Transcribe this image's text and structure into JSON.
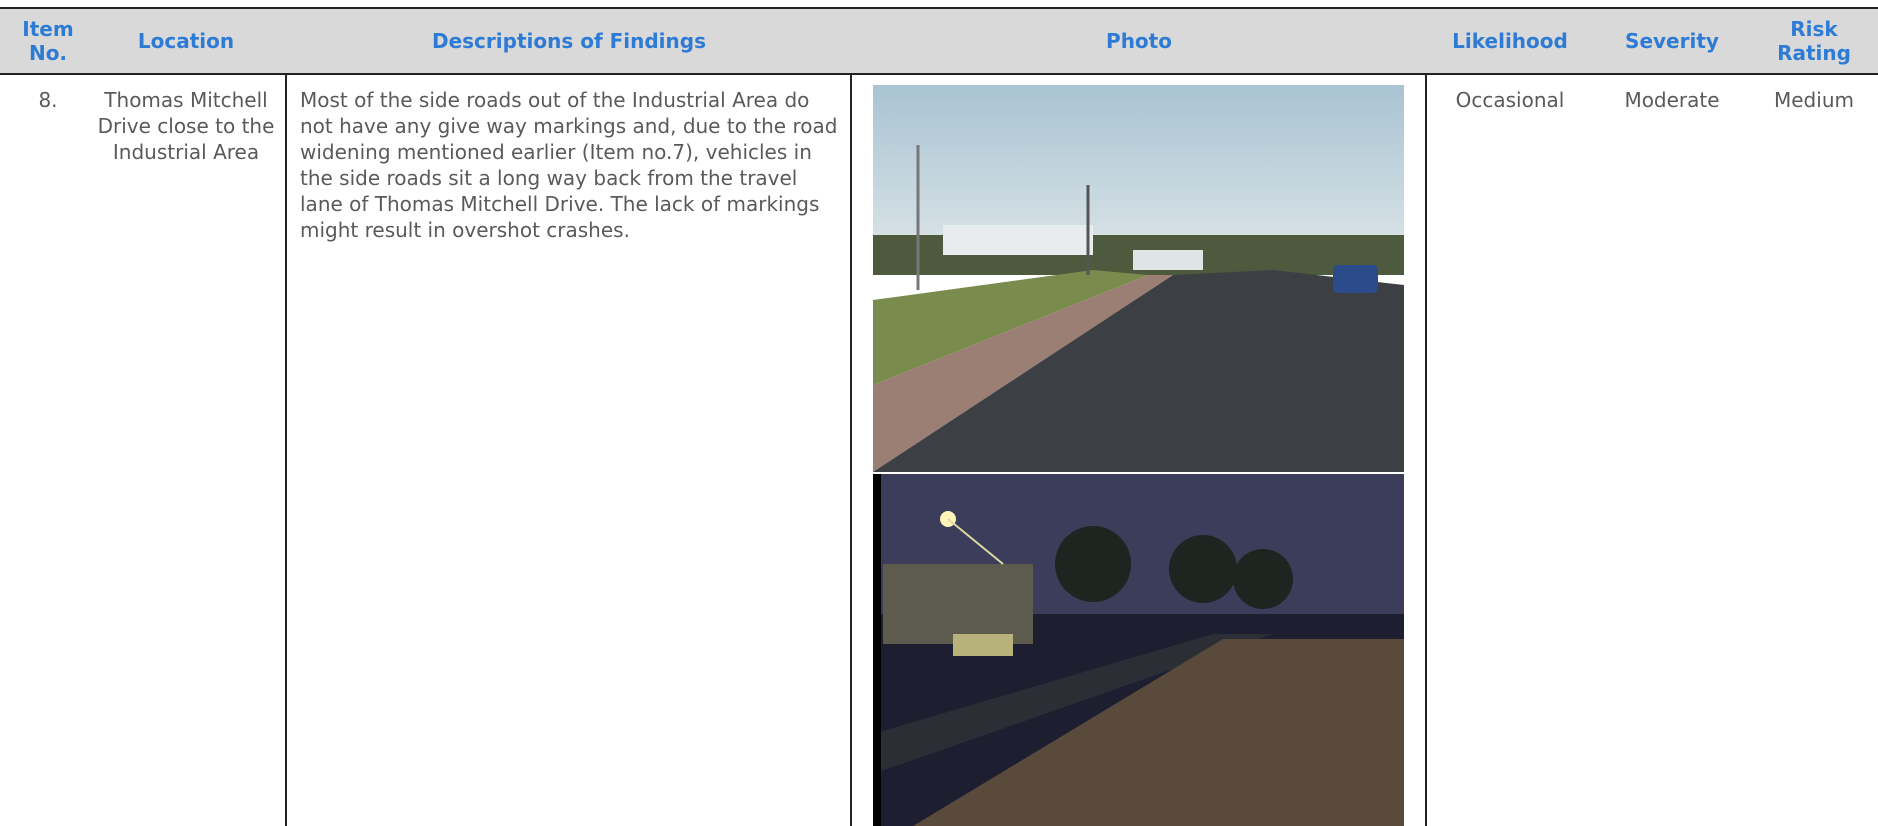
{
  "header": {
    "item_no": "Item No.",
    "location": "Location",
    "descriptions": "Descriptions of Findings",
    "photo": "Photo",
    "likelihood": "Likelihood",
    "severity": "Severity",
    "risk_rating": "Risk Rating"
  },
  "row": {
    "item_no": "8.",
    "location": "Thomas Mitchell Drive close to the Industrial Area",
    "description": "Most of the side roads out of the Industrial Area do not have any give way markings and, due to the road widening mentioned earlier (Item no.7), vehicles in the side roads sit a long way back from the travel lane of Thomas Mitchell Drive. The lack of markings might result in overshot crashes.",
    "likelihood": "Occasional",
    "severity": "Moderate",
    "risk_rating": "Medium"
  },
  "colors": {
    "header_text": "#2e7bd6",
    "header_bg": "#d9d9d9",
    "body_text": "#5a5a5a"
  }
}
